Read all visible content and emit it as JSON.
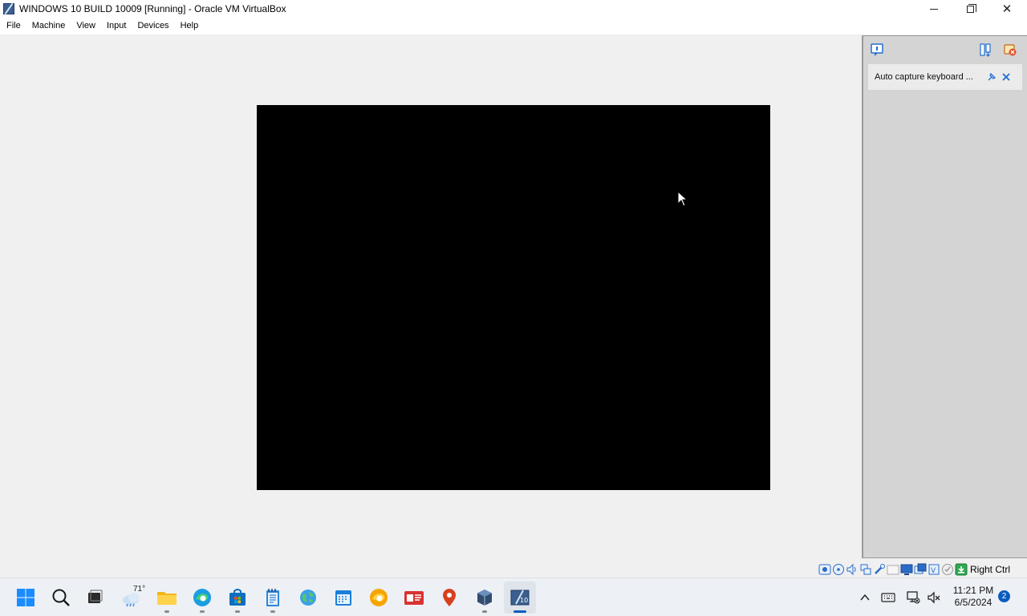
{
  "window": {
    "title": "WINDOWS 10 BUILD 10009 [Running] - Oracle VM VirtualBox"
  },
  "menu": {
    "items": [
      "File",
      "Machine",
      "View",
      "Input",
      "Devices",
      "Help"
    ]
  },
  "notification_panel": {
    "message": "Auto capture keyboard ..."
  },
  "statusbar": {
    "host_key_label": "Right Ctrl",
    "icons": [
      "hard-disk-icon",
      "optical-drive-icon",
      "audio-icon",
      "network-icon",
      "usb-icon",
      "shared-folders-icon",
      "display-icon",
      "video-capture-icon",
      "recording-icon",
      "cpu-icon",
      "mouse-integration-icon",
      "keyboard-capture-icon"
    ]
  },
  "taskbar": {
    "weather_temp": "71°",
    "clock_time": "11:21 PM",
    "clock_date": "6/5/2024",
    "notification_count": "2",
    "apps": [
      "start",
      "search",
      "task-view",
      "weather",
      "file-explorer",
      "edge",
      "store",
      "notepad",
      "maps",
      "calendar",
      "edge-canary",
      "news",
      "location",
      "virtualbox",
      "virtualbox-vm"
    ]
  },
  "colors": {
    "vm_screen": "#000000",
    "accent": "#0a5dbf",
    "panel": "#d4d4d4"
  }
}
